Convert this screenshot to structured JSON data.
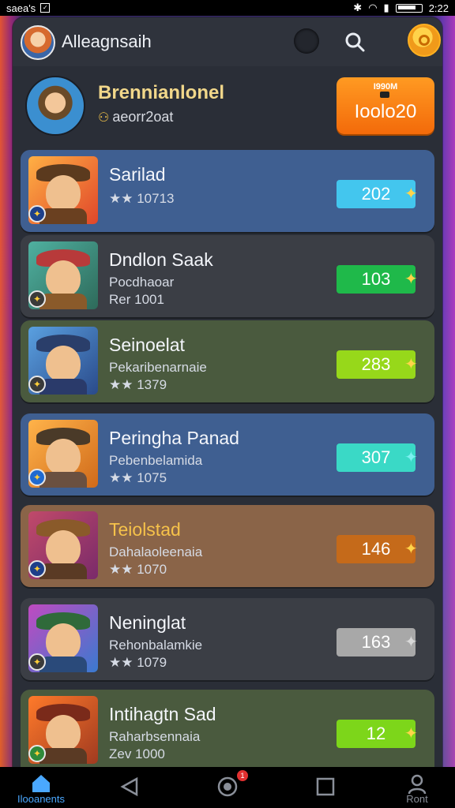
{
  "status_bar": {
    "left_text": "saea's",
    "time": "2:22"
  },
  "header": {
    "title": "Alleagnsaih"
  },
  "profile": {
    "name": "Brennianlonel",
    "subtitle": "aeorr2oat",
    "badge_top": "I990M",
    "badge_value": "Ioolo20"
  },
  "items": [
    {
      "title": "Sarilad",
      "sub": "",
      "sub2": "★★ 10713",
      "score": "202",
      "score_color": "#43c6ee",
      "card_color": "#3f5f91"
    },
    {
      "title": "Dndlon Saak",
      "sub": "Pocdhaoar",
      "sub2": "Rer 1001",
      "score": "103",
      "score_color": "#1fb94a",
      "card_color": "#3b3e45"
    },
    {
      "title": "Seinoelat",
      "sub": "Pekaribenarnaie",
      "sub2": "★★ 1379",
      "score": "283",
      "score_color": "#97d81a",
      "card_color": "#4a5a3e"
    },
    {
      "title": "Peringha Panad",
      "sub": "Pebenbelamida",
      "sub2": "★★ 1075",
      "score": "307",
      "score_color": "#3ad9c6",
      "card_color": "#3f5f91"
    },
    {
      "title": "Teiolstad",
      "sub": "Dahalaoleenaia",
      "sub2": "★★ 1070",
      "score": "146",
      "score_color": "#c56a1a",
      "card_color": "#8a6448"
    },
    {
      "title": "Neninglat",
      "sub": "Rehonbalamkie",
      "sub2": "★★ 1079",
      "score": "163",
      "score_color": "#a8a8a8",
      "card_color": "#3b3e45"
    },
    {
      "title": "Intihagtn Sad",
      "sub": "Raharbsennaia",
      "sub2": "Zev 1000",
      "score": "12",
      "score_color": "#7dd61a",
      "card_color": "#4a5a3e"
    }
  ],
  "nav": [
    {
      "label": "Ilooanents"
    },
    {
      "label": "",
      "badge": "1"
    },
    {
      "label": ""
    },
    {
      "label": ""
    },
    {
      "label": "Ront"
    }
  ]
}
